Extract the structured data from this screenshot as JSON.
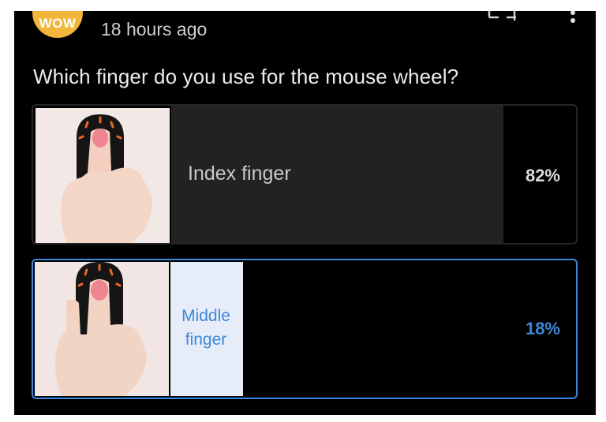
{
  "post": {
    "badge": "WOW",
    "timestamp": "18 hours ago"
  },
  "poll": {
    "question": "Which finger do you use for the mouse wheel?",
    "options": [
      {
        "label": "Index finger",
        "percent_label": "82%",
        "percent": 82,
        "selected": false,
        "image": "hand-on-mouse-index-finger"
      },
      {
        "label": "Middle finger",
        "percent_label": "18%",
        "percent": 18,
        "selected": true,
        "image": "hand-on-mouse-middle-finger"
      }
    ]
  },
  "icons": {
    "top_right": "more-vertical-icon",
    "top_center": "share-icon"
  },
  "colors": {
    "background": "#000000",
    "accent": "#3d87d8",
    "badge": "#f2b73a",
    "bar_fill": "#222222",
    "selected_fill": "#e7edf8"
  }
}
